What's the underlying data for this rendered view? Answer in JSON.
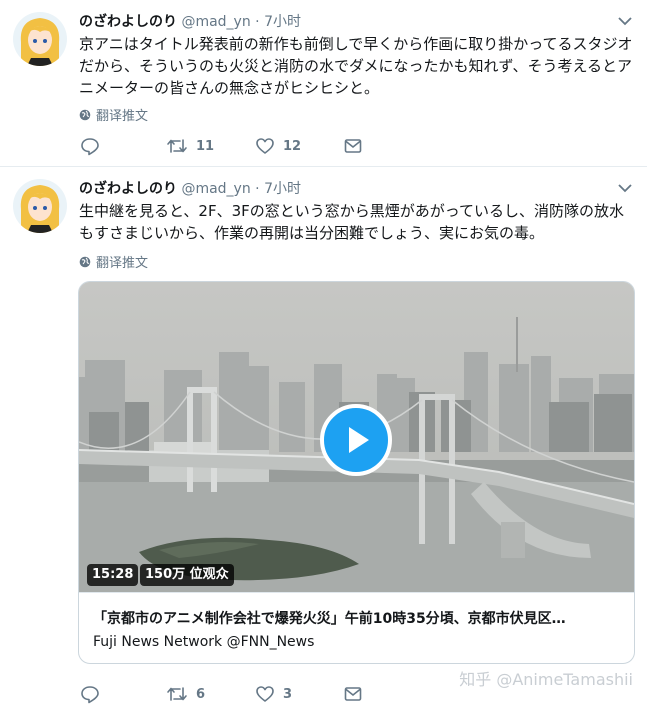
{
  "tweets": [
    {
      "display_name": "のざわよしのり",
      "handle": "@mad_yn",
      "separator": "·",
      "time": "7小时",
      "text": "京アニはタイトル発表前の新作も前倒しで早くから作画に取り掛かってるスタジオだから、そういうのも火災と消防の水でダメになったかも知れず、そう考えるとアニメーターの皆さんの無念さがヒシヒシと。",
      "translate_label": "翻译推文",
      "reply_count": "",
      "retweet_count": "11",
      "like_count": "12"
    },
    {
      "display_name": "のざわよしのり",
      "handle": "@mad_yn",
      "separator": "·",
      "time": "7小时",
      "text": "生中継を見ると、2F、3Fの窓という窓から黒煙があがっているし、消防隊の放水もすさまじいから、作業の再開は当分困難でしょう、実にお気の毒。",
      "translate_label": "翻译推文",
      "reply_count": "",
      "retweet_count": "6",
      "like_count": "3",
      "card": {
        "duration": "15:28",
        "views": "150万 位观众",
        "title": "「京都市のアニメ制作会社で爆発火災」午前10時35分頃、京都市伏見区…",
        "source": "Fuji News Network @FNN_News"
      }
    }
  ],
  "watermark": "知乎 @AnimeTamashii",
  "colors": {
    "accent": "#1da1f2",
    "muted": "#657786",
    "text": "#14171a",
    "border": "#e6ecf0"
  },
  "icons": [
    "reply-icon",
    "retweet-icon",
    "like-icon",
    "message-icon",
    "globe-icon",
    "chevron-down-icon",
    "play-icon"
  ]
}
